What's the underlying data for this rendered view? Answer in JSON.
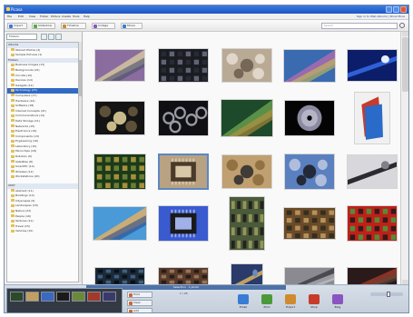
{
  "window": {
    "title": "Picasa"
  },
  "menu": {
    "items": [
      "File",
      "Edit",
      "View",
      "Folder",
      "Picture",
      "Create",
      "Tools",
      "Help"
    ],
    "links": "Sign in to Web Albums | Show More"
  },
  "toolbar": {
    "buttons": [
      {
        "label": "Import",
        "color": "#3a7bd5"
      },
      {
        "label": "Slideshow",
        "color": "#55aa44"
      },
      {
        "label": "Timeline",
        "color": "#d08a30"
      },
      {
        "label": "Collage",
        "color": "#8a55c0"
      },
      {
        "label": "Movie",
        "color": "#3a7bd5"
      }
    ],
    "search_placeholder": "Search"
  },
  "sidebar": {
    "filter_label": "Folders",
    "tree": [
      {
        "label": "Albums",
        "type": "head"
      },
      {
        "label": "Starred Photos (4)",
        "type": "item"
      },
      {
        "label": "Sample Pictures (1)",
        "type": "item"
      },
      {
        "label": "Folders",
        "type": "head"
      },
      {
        "label": "Business Images (13)",
        "type": "item"
      },
      {
        "label": "Backgrounds (22)",
        "type": "item"
      },
      {
        "label": "Circuits (10)",
        "type": "item"
      },
      {
        "label": "Devices (14)",
        "type": "item"
      },
      {
        "label": "Gadgets (12)",
        "type": "item"
      },
      {
        "label": "Technology (25)",
        "type": "selected"
      },
      {
        "label": "Computers (17)",
        "type": "item"
      },
      {
        "label": "Hardware (14)",
        "type": "item"
      },
      {
        "label": "Software (18)",
        "type": "item"
      },
      {
        "label": "Internet Concepts (21)",
        "type": "item"
      },
      {
        "label": "Communications (12)",
        "type": "item"
      },
      {
        "label": "Data Storage (11)",
        "type": "item"
      },
      {
        "label": "Networks (15)",
        "type": "item"
      },
      {
        "label": "Electronics (19)",
        "type": "item"
      },
      {
        "label": "Components (13)",
        "type": "item"
      },
      {
        "label": "Engineering (16)",
        "type": "item"
      },
      {
        "label": "Laboratory (10)",
        "type": "item"
      },
      {
        "label": "Microchips (18)",
        "type": "item"
      },
      {
        "label": "Robotics (9)",
        "type": "item"
      },
      {
        "label": "Satellites (8)",
        "type": "item"
      },
      {
        "label": "Scientific (14)",
        "type": "item"
      },
      {
        "label": "Wireless (12)",
        "type": "item"
      },
      {
        "label": "Workstations (20)",
        "type": "item"
      },
      {
        "label": "",
        "type": "sep"
      },
      {
        "label": "2007",
        "type": "head"
      },
      {
        "label": "Abstract (11)",
        "type": "item"
      },
      {
        "label": "Buildings (14)",
        "type": "item"
      },
      {
        "label": "Cityscapes (9)",
        "type": "item"
      },
      {
        "label": "Landscapes (18)",
        "type": "item"
      },
      {
        "label": "Nature (22)",
        "type": "item"
      },
      {
        "label": "People (16)",
        "type": "item"
      },
      {
        "label": "Textures (12)",
        "type": "item"
      },
      {
        "label": "Travel (15)",
        "type": "item"
      },
      {
        "label": "Vehicles (10)",
        "type": "item"
      }
    ]
  },
  "photos": [
    {
      "name": "Circuit board purple",
      "colors": [
        "#8a6d9e",
        "#d8c9a0",
        "#4a4f6a"
      ],
      "style": "diag"
    },
    {
      "name": "Keyboard keys",
      "colors": [
        "#1a1c22",
        "#6d7180",
        "#2a2d36"
      ],
      "style": "grid"
    },
    {
      "name": "Gears cogs",
      "colors": [
        "#b9aa95",
        "#6a5c4c",
        "#e6dfd3"
      ],
      "style": "dots"
    },
    {
      "name": "Colorful chip",
      "colors": [
        "#3a6ab0",
        "#b06ab0",
        "#c8c050"
      ],
      "style": "diag"
    },
    {
      "name": "Blue light fiber",
      "colors": [
        "#0c1e6a",
        "#3060d8",
        "#e6efff"
      ],
      "style": "beam"
    },
    {
      "name": "Plugs and connectors",
      "colors": [
        "#141414",
        "#e8d7a0",
        "#6a5a40"
      ],
      "style": "dots"
    },
    {
      "name": "Washers rings",
      "colors": [
        "#101014",
        "#9a9aa4",
        "#3a3a44"
      ],
      "style": "rings"
    },
    {
      "name": "Green circuit",
      "colors": [
        "#1d4a2a",
        "#6aa050",
        "#c09040"
      ],
      "style": "diag"
    },
    {
      "name": "CD disc",
      "colors": [
        "#040404",
        "#8a8aa0",
        "#d0d0e0"
      ],
      "style": "disc"
    },
    {
      "name": "Color swatches",
      "colors": [
        "#f0f0f0",
        "#c83a2a",
        "#2a6ac8"
      ],
      "style": "stack"
    },
    {
      "name": "PCB green gold",
      "colors": [
        "#1a3a1a",
        "#7a8a3a",
        "#c0a040"
      ],
      "style": "grid"
    },
    {
      "name": "Microprocessor",
      "colors": [
        "#b8a282",
        "#4a3a2a",
        "#d8c8a8"
      ],
      "style": "chip"
    },
    {
      "name": "Resistors on board",
      "colors": [
        "#c0a070",
        "#2a2a2a",
        "#8a6a3a"
      ],
      "style": "dots"
    },
    {
      "name": "Chips on blue",
      "colors": [
        "#5a80c0",
        "#1a1a20",
        "#c0c8e0"
      ],
      "style": "dots"
    },
    {
      "name": "Cable plug",
      "colors": [
        "#d8d8dc",
        "#2a2a30",
        "#80808a"
      ],
      "style": "beam"
    },
    {
      "name": "Capacitors on blue",
      "colors": [
        "#4a9ad8",
        "#e8b060",
        "#2a4a8a"
      ],
      "style": "diag"
    },
    {
      "name": "IC chip blue",
      "colors": [
        "#3a5ad0",
        "#1a1a1a",
        "#a0b0e8"
      ],
      "style": "chip"
    },
    {
      "name": "Tower electronics",
      "colors": [
        "#4a5a3a",
        "#1a1a1a",
        "#a0a060"
      ],
      "style": "grid"
    },
    {
      "name": "Board close-up",
      "colors": [
        "#6a4a2a",
        "#c0a060",
        "#2a2a1a"
      ],
      "style": "grid"
    },
    {
      "name": "Red circuit card",
      "colors": [
        "#c0201a",
        "#1a1a1a",
        "#40a040"
      ],
      "style": "grid"
    },
    {
      "name": "Dark board",
      "colors": [
        "#1a2a3a",
        "#4a6a8a",
        "#0a0a0a"
      ],
      "style": "grid"
    },
    {
      "name": "Brown chips",
      "colors": [
        "#5a3a2a",
        "#a08060",
        "#1a1a1a"
      ],
      "style": "grid"
    },
    {
      "name": "Blue tower",
      "colors": [
        "#2a3a6a",
        "#c0a060",
        "#6a8ac0"
      ],
      "style": "beam"
    },
    {
      "name": "Grey components",
      "colors": [
        "#8a8a90",
        "#3a3a40",
        "#d0d0d8"
      ],
      "style": "diag"
    },
    {
      "name": "Red dark board",
      "colors": [
        "#2a1a1a",
        "#a03a2a",
        "#5a4a3a"
      ],
      "style": "diag"
    }
  ],
  "bottom": {
    "tray_label": "Selection  ·  1 photo",
    "tray_colors": [
      "#2a4a2a",
      "#c0a060",
      "#3a6ac0",
      "#1a1a1a",
      "#6a8a3a",
      "#a03a2a",
      "#3a3a6a"
    ],
    "tray_actions": [
      {
        "label": "Hold"
      },
      {
        "label": "Clear"
      },
      {
        "label": "Add"
      }
    ],
    "pager": "1 / 25",
    "tools": [
      {
        "label": "Email",
        "color": "#3a7bd5"
      },
      {
        "label": "Print",
        "color": "#4a9a3a"
      },
      {
        "label": "Export",
        "color": "#d08a30"
      },
      {
        "label": "Shop",
        "color": "#c83a2a"
      },
      {
        "label": "Blog",
        "color": "#8a55c0"
      }
    ]
  }
}
